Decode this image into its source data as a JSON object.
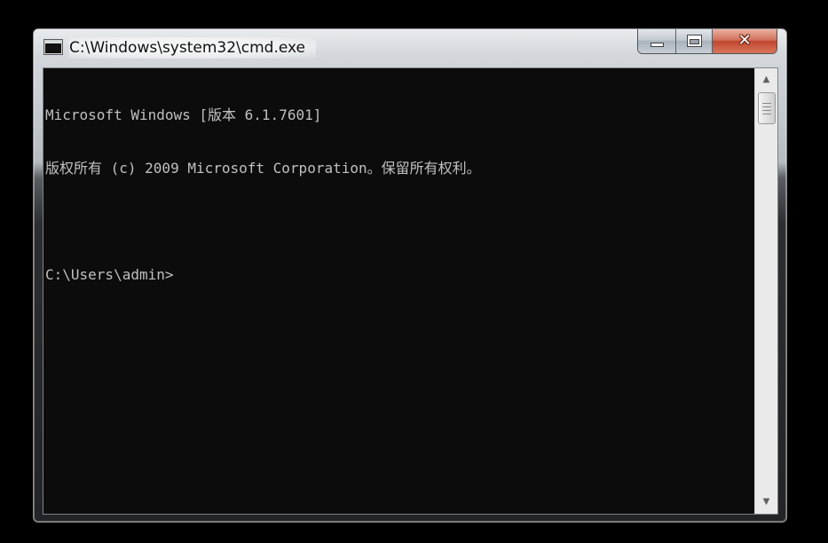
{
  "window": {
    "title": "C:\\Windows\\system32\\cmd.exe",
    "icon": "cmd-console-icon",
    "icon_text": "C:\\"
  },
  "caption_buttons": {
    "minimize": "minimize-icon",
    "maximize": "maximize-icon",
    "close": "close-icon",
    "close_glyph": "✕"
  },
  "console": {
    "lines": [
      "Microsoft Windows [版本 6.1.7601]",
      "版权所有 (c) 2009 Microsoft Corporation。保留所有权利。",
      "",
      "C:\\Users\\admin>"
    ],
    "foreground": "#c0c0c0",
    "background": "#0c0c0c"
  },
  "scrollbar": {
    "up_glyph": "▲",
    "down_glyph": "▼",
    "up_icon": "scroll-up-arrow-icon",
    "down_icon": "scroll-down-arrow-icon"
  }
}
